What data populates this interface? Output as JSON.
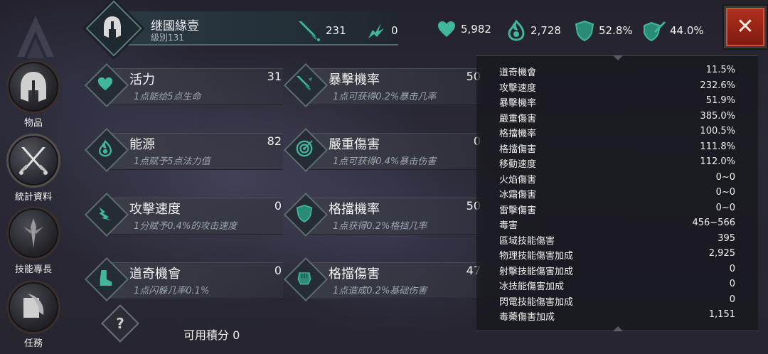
{
  "nav": {
    "items": [
      {
        "label": "物品",
        "icon": "helmet-icon"
      },
      {
        "label": "統計資料",
        "icon": "crossed-swords-icon"
      },
      {
        "label": "技能專長",
        "icon": "skill-tree-icon"
      },
      {
        "label": "任務",
        "icon": "scroll-quill-icon"
      }
    ]
  },
  "header": {
    "name": "继國緣壹",
    "level": "級別131",
    "attack": "231",
    "spell": "0",
    "health": "5,982",
    "mana": "2,728",
    "armor": "52.8%",
    "resist": "44.0%"
  },
  "attributes": [
    {
      "name": "活力",
      "value": "31",
      "desc": "1点能给5点生命",
      "icon": "heart-icon"
    },
    {
      "name": "暴擊機率",
      "value": "50",
      "desc": "1点可获得0.2%暴击几率",
      "icon": "sword-slash-icon"
    },
    {
      "name": "能源",
      "value": "82",
      "desc": "1点赋予5点法力值",
      "icon": "energy-flame-icon"
    },
    {
      "name": "嚴重傷害",
      "value": "0",
      "desc": "1点可获得0.4%暴击伤害",
      "icon": "target-icon"
    },
    {
      "name": "攻擊速度",
      "value": "0",
      "desc": "1分赋予0.4%的攻击速度",
      "icon": "winged-hand-icon"
    },
    {
      "name": "格擋機率",
      "value": "50",
      "desc": "1点获得0.2%格挡几率",
      "icon": "shield-icon"
    },
    {
      "name": "道奇機會",
      "value": "0",
      "desc": "1点闪躲几率0.1%",
      "icon": "boot-icon"
    },
    {
      "name": "格擋傷害",
      "value": "47",
      "desc": "1点造成0.2%基础伤害",
      "icon": "gauntlet-icon"
    }
  ],
  "points": {
    "label": "可用積分 0",
    "help": "?"
  },
  "stats": [
    {
      "k": "道奇機會",
      "v": "11.5%"
    },
    {
      "k": "攻擊速度",
      "v": "232.6%"
    },
    {
      "k": "暴擊機率",
      "v": "51.9%"
    },
    {
      "k": "嚴重傷害",
      "v": "385.0%"
    },
    {
      "k": "格擋機率",
      "v": "100.5%"
    },
    {
      "k": "格擋傷害",
      "v": "111.8%"
    },
    {
      "k": "移動速度",
      "v": "112.0%"
    },
    {
      "k": "火焰傷害",
      "v": "0~0"
    },
    {
      "k": "冰霜傷害",
      "v": "0~0"
    },
    {
      "k": "雷擊傷害",
      "v": "0~0"
    },
    {
      "k": "毒害",
      "v": "456~566"
    },
    {
      "k": "區域技能傷害",
      "v": "395"
    },
    {
      "k": "物理技能傷害加成",
      "v": "2,925"
    },
    {
      "k": "射擊技能傷害加成",
      "v": "0"
    },
    {
      "k": "冰技能傷害加成",
      "v": "0"
    },
    {
      "k": "閃電技能傷害加成",
      "v": "0"
    },
    {
      "k": "毒藥傷害加成",
      "v": "1,151"
    }
  ],
  "close_label": "✕",
  "colors": {
    "accent_teal": "#3fb89a",
    "close_red": "#a5281a"
  }
}
